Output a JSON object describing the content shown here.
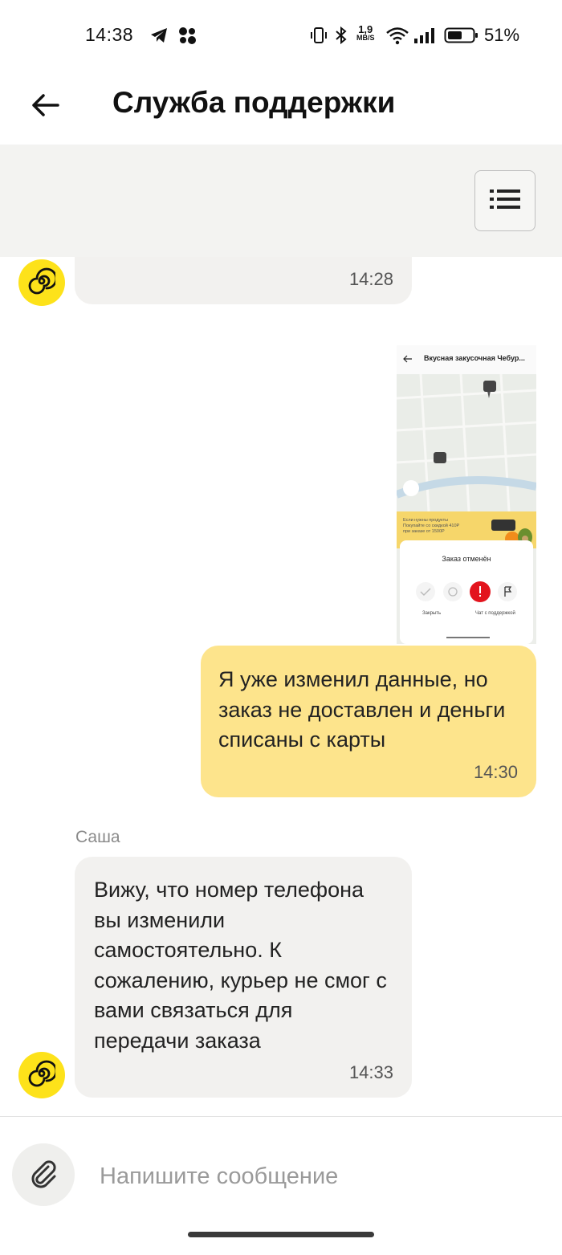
{
  "status_bar": {
    "time": "14:38",
    "net_speed_value": "1,9",
    "net_speed_unit": "MB/S",
    "battery_percent": "51%",
    "icons": [
      "telegram-icon",
      "app-dots-icon",
      "vibrate-icon",
      "bluetooth-icon",
      "wifi-icon",
      "signal-icon",
      "battery-icon"
    ]
  },
  "header": {
    "title": "Служба поддержки",
    "back_icon": "arrow-left-icon"
  },
  "subbar": {
    "menu_icon": "list-menu-icon"
  },
  "messages": [
    {
      "direction": "incoming",
      "partial_text": "·",
      "time": "14:28"
    },
    {
      "direction": "outgoing",
      "attachment": {
        "type": "screenshot",
        "title": "Вкусная закусочная Чебур...",
        "banner_text": "Если нужны продукты Покупайте со скидкой 410Р при заказе от 1500Р",
        "status": "Заказ отменён",
        "close_label": "Закрыть",
        "chat_label": "Чат с поддержкой"
      },
      "text": "Я уже изменил данные, но заказ не доставлен и деньги списаны с карты",
      "time": "14:30"
    },
    {
      "direction": "incoming",
      "sender": "Саша",
      "text": "Вижу, что номер телефона вы изменили самостоятельно. К сожалению, курьер не смог с вами связаться для передачи заказа",
      "time": "14:33"
    }
  ],
  "composer": {
    "placeholder": "Напишите сообщение",
    "value": "",
    "attach_icon": "paperclip-icon"
  },
  "colors": {
    "outgoing_bubble": "#fde48c",
    "incoming_bubble": "#f2f1ef",
    "avatar": "#fde21a",
    "subbar": "#f3f3f1"
  }
}
